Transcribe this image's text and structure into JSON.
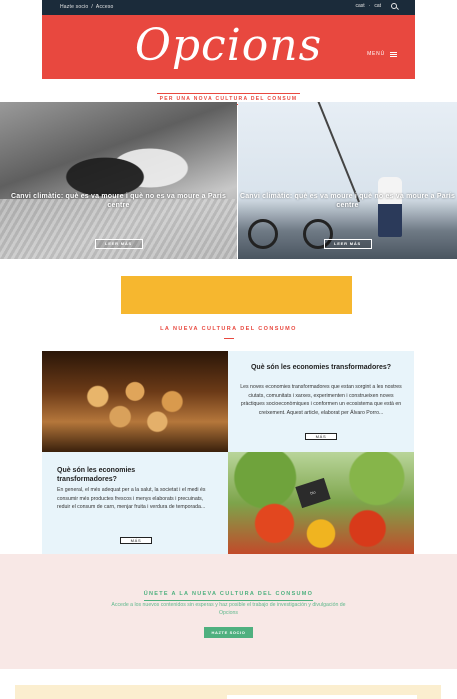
{
  "topbar": {
    "join_label": "Hazte socio",
    "separator": "/",
    "access_label": "Acceso",
    "lang_cast": "cast",
    "lang_dot": "·",
    "lang_cat": "cat",
    "search_icon": "search-icon"
  },
  "header": {
    "logo": "Opcions",
    "menu_label": "MENÚ",
    "menu_icon": "hamburger-icon",
    "brand_color": "#e8483f"
  },
  "tagline": "PER UNA NOVA CULTURA DEL CONSUM",
  "features": [
    {
      "title": "Canvi climàtic: què es va moure i què no es va moure a París centre",
      "button": "LEER MÁS"
    },
    {
      "title": "Canvi climàtic: què es va moure i què no es va moure a París centre",
      "button": "LEER MÁS"
    }
  ],
  "ad": {
    "color": "#f6b72f"
  },
  "section": {
    "title": "LA NUEVA CULTURA DEL CONSUMO",
    "cards": [
      {
        "title": "Què són les economies transformadores?",
        "text": "Les noves economies transformadores que estan sorgint a les nostres ciutats, comunitats i xarxes, experimenten i construeixen noves pràctiques socioeconòmiques i conformen un ecosistema que està en creixement. Aquest article, elaborat per Álvaro Porro...",
        "button": "MÁS"
      },
      {
        "title": "Què són les economies transformadores?",
        "text": "En general, el més adequat per a la salut, la societat i el medi és consumir més productes frescos i menys elaborats i precuinats, reduir el consum de carn, menjar fruita i verdura de temporada...",
        "button": "MÁS"
      }
    ],
    "chalkboard": "bio"
  },
  "cta": {
    "title": "ÚNETE A LA NUEVA CULTURA DEL CONSUMO",
    "text": "Accede a los nuevos contenidos sin esperas y haz posible el trabajo de investigación y divulgación de Opcions",
    "button": "HAZTE SOCIO",
    "accent": "#4fb07f",
    "background": "#f8e8e6"
  }
}
